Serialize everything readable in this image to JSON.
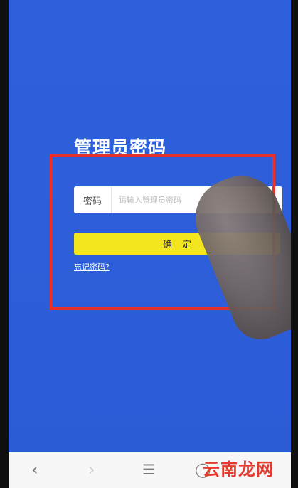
{
  "page": {
    "title": "管理员密码"
  },
  "login": {
    "password_label": "密码",
    "password_placeholder": "请输入管理员密码",
    "confirm_label": "确定",
    "forgot_label": "忘记密码?"
  },
  "nav": {
    "back_glyph": "‹",
    "forward_glyph": "›",
    "menu_glyph": "☰",
    "home_glyph": "◯"
  },
  "watermark": {
    "text": "云南龙网"
  },
  "colors": {
    "background": "#2d5ed9",
    "button": "#f3e51e",
    "highlight": "#e8302b",
    "watermark": "#e53a2e"
  }
}
